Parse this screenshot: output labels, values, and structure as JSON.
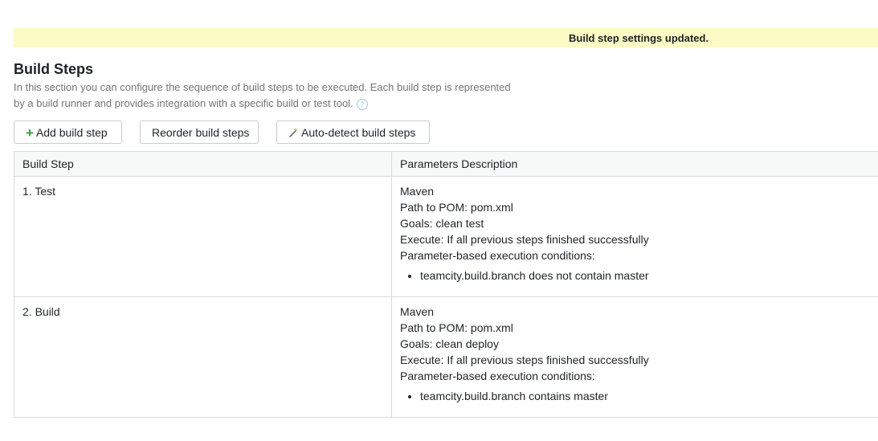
{
  "notice": {
    "text": "Build step settings updated."
  },
  "section": {
    "title": "Build Steps",
    "description_line1": "In this section you can configure the sequence of build steps to be executed. Each build step is represented",
    "description_line2": "by a build runner and provides integration with a specific build or test tool.",
    "help_icon": "question-mark-icon"
  },
  "toolbar": {
    "add_label": "Add build step",
    "reorder_label": "Reorder build steps",
    "autodetect_label": "Auto-detect build steps",
    "add_icon": "plus-icon",
    "autodetect_icon": "magic-wand-icon"
  },
  "table": {
    "headers": [
      "Build Step",
      "Parameters Description"
    ],
    "rows": [
      {
        "step": "1. Test",
        "runner": "Maven",
        "pom": "Path to POM: pom.xml",
        "goals": "Goals: clean test",
        "execute": "Execute: If all previous steps finished successfully",
        "conditions_label": "Parameter-based execution conditions:",
        "conditions": [
          "teamcity.build.branch does not contain master"
        ]
      },
      {
        "step": "2. Build",
        "runner": "Maven",
        "pom": "Path to POM: pom.xml",
        "goals": "Goals: clean deploy",
        "execute": "Execute: If all previous steps finished successfully",
        "conditions_label": "Parameter-based execution conditions:",
        "conditions": [
          "teamcity.build.branch contains master"
        ]
      }
    ]
  },
  "colors": {
    "notice_bg": "#fdfbc5",
    "add_icon": "#23a844",
    "border": "#d9dadb",
    "muted_text": "#737577"
  }
}
